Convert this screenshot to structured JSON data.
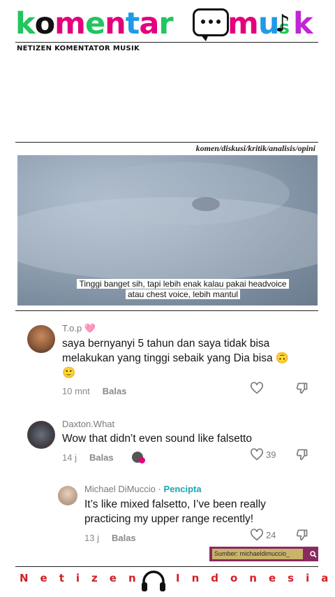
{
  "header": {
    "logo_part1": "komentar",
    "logo_part2": "mu",
    "logo_part3": "ik",
    "tagline": "NETIZEN KOMENTATOR MUSIK",
    "categories": "komen/diskusi/kritik/analisis/opini"
  },
  "video": {
    "subtitle_line1": "Tinggi banget sih, tapi lebih enak kalau pakai headvoice",
    "subtitle_line2": "atau chest voice, lebih mantul"
  },
  "comments": [
    {
      "username": "T.o.p",
      "emoji": "🩷",
      "text": "saya bernyanyi 5 tahun dan saya tidak bisa melakukan yang tinggi sebaik yang Dia bisa 🙃🙂",
      "time": "10 mnt",
      "reply_label": "Balas"
    },
    {
      "username": "Daxton.What",
      "text": "Wow that didn’t even sound like falsetto",
      "time": "14 j",
      "reply_label": "Balas",
      "likes": "39"
    },
    {
      "username": "Michael DiMuccio",
      "separator": " · ",
      "creator_badge": "Pencipta",
      "text": "It’s like mixed falsetto, I’ve been really practicing my upper range recently!",
      "time": "13 j",
      "reply_label": "Balas",
      "likes": "24"
    }
  ],
  "source": {
    "label": "Sumber: michaeldimuccio_"
  },
  "footer": {
    "word1": "Netizen",
    "word2": "Indonesia"
  },
  "colors": {
    "logo_k": "#22c55e",
    "logo_o": "#111111",
    "logo_m": "#e4007c",
    "logo_e": "#22c55e",
    "logo_n": "#e4007c",
    "logo_t": "#1e9be6",
    "logo_a": "#e4007c",
    "logo_r": "#22c55e",
    "footer_red": "#d32027",
    "creator_teal": "#1aa6b8",
    "source_bg": "#8a2b5f"
  }
}
